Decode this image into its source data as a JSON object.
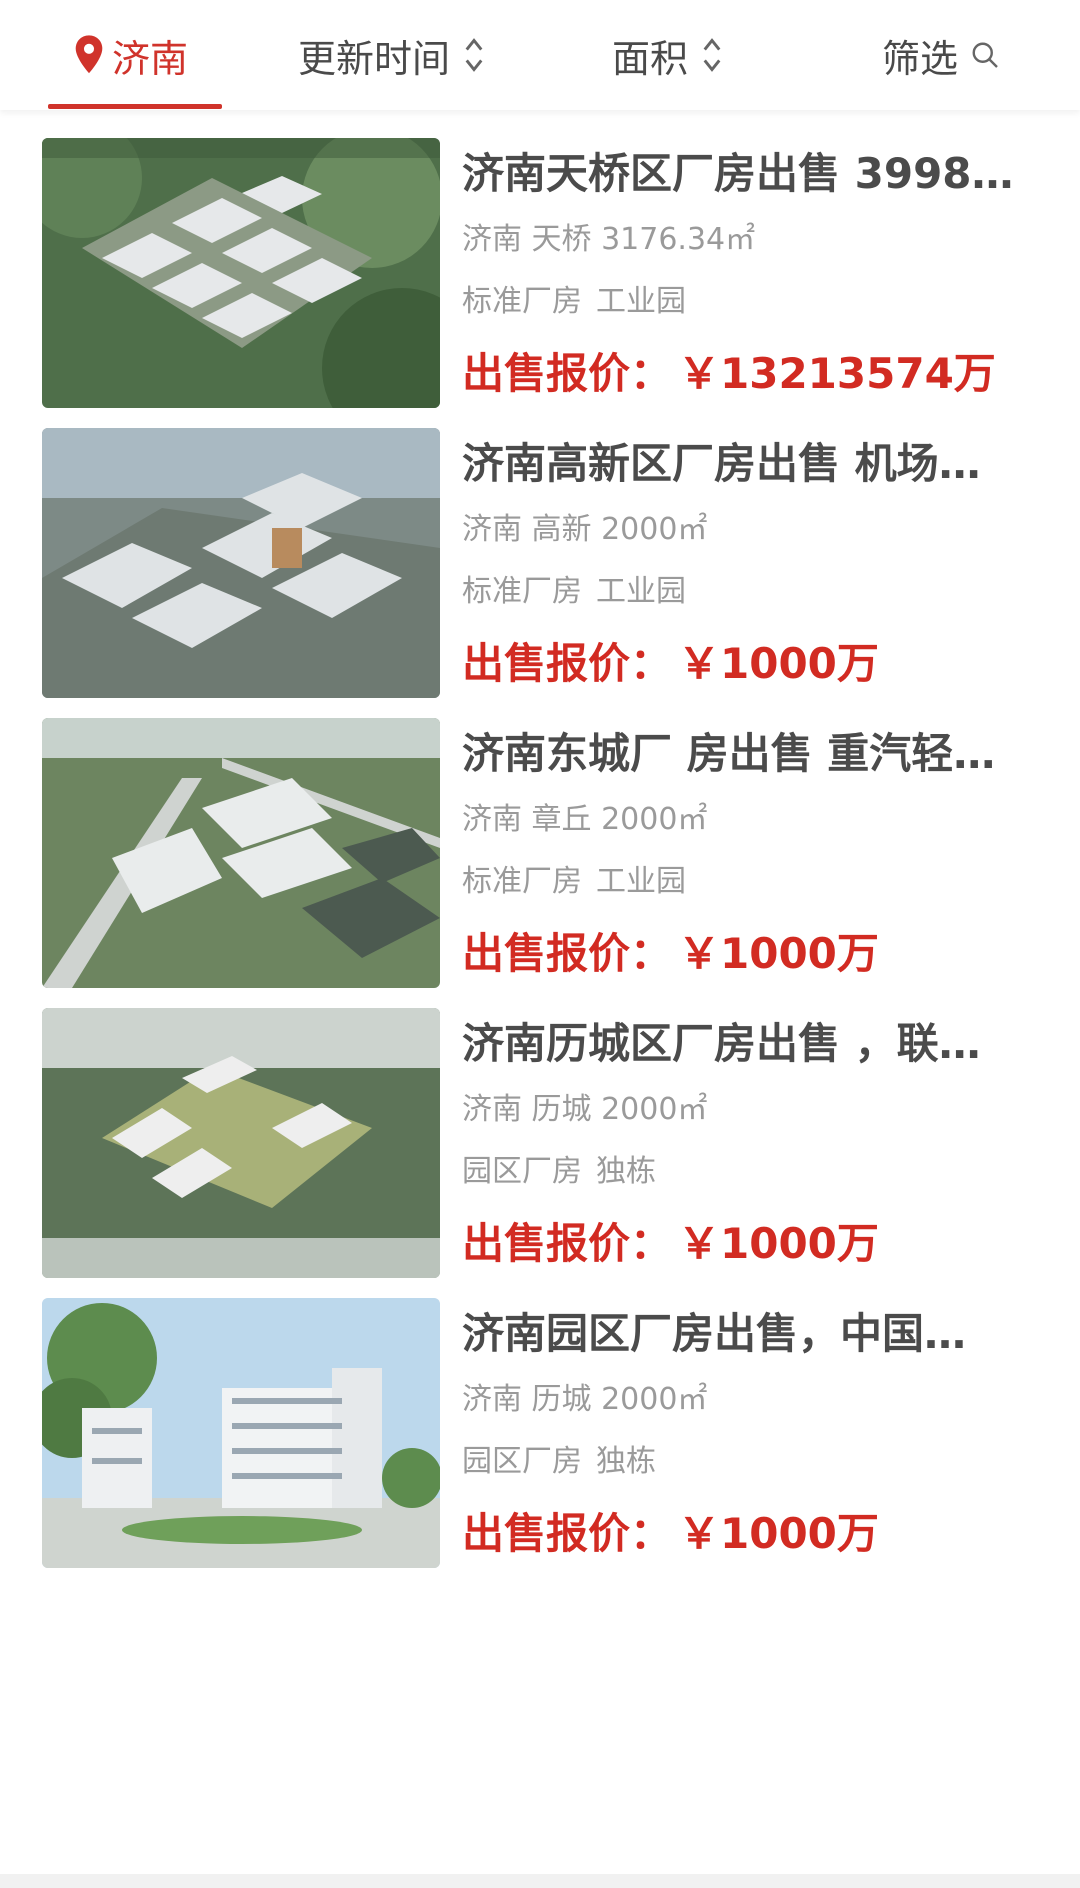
{
  "filter_bar": {
    "city": "济南",
    "sort_time": "更新时间",
    "sort_area": "面积",
    "filter": "筛选",
    "icons": {
      "city": "location-pin-icon",
      "sort": "sort-updown-icon",
      "filter": "search-icon"
    },
    "accent_color": "#d0332b"
  },
  "listings": [
    {
      "title": "济南天桥区厂房出售 3998…",
      "location": "济南 天桥 3176.34㎡",
      "tags": [
        "标准厂房",
        "工业园"
      ],
      "price_label": "出售报价：",
      "price_value": "￥13213574万",
      "image": "aerial-industrial-park-green"
    },
    {
      "title": "济南高新区厂房出售 机场…",
      "location": "济南 高新 2000㎡",
      "tags": [
        "标准厂房",
        "工业园"
      ],
      "price_label": "出售报价：",
      "price_value": "￥1000万",
      "image": "aerial-industrial-park-gray"
    },
    {
      "title": "济南东城厂 房出售 重汽轻…",
      "location": "济南 章丘 2000㎡",
      "tags": [
        "标准厂房",
        "工业园"
      ],
      "price_label": "出售报价：",
      "price_value": "￥1000万",
      "image": "aerial-industrial-park-roads"
    },
    {
      "title": "济南历城区厂房出售 ，联…",
      "location": "济南 历城 2000㎡",
      "tags": [
        "园区厂房",
        "独栋"
      ],
      "price_label": "出售报价：",
      "price_value": "￥1000万",
      "image": "aerial-industrial-park-clouds"
    },
    {
      "title": "济南园区厂房出售，中国…",
      "location": "济南 历城 2000㎡",
      "tags": [
        "园区厂房",
        "独栋"
      ],
      "price_label": "出售报价：",
      "price_value": "￥1000万",
      "image": "street-view-factory-buildings"
    }
  ],
  "price_color": "#d22b22"
}
